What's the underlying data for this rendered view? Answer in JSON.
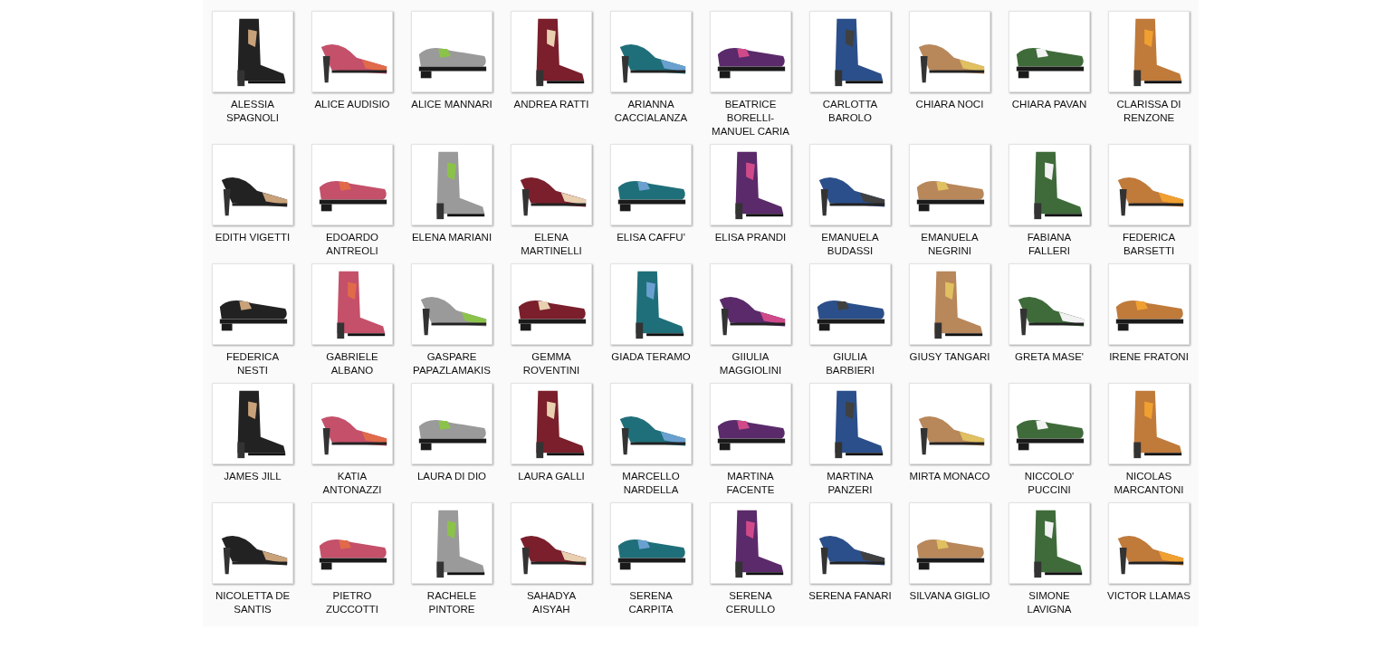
{
  "items": [
    {
      "name": "ALESSIA SPAGNOLI"
    },
    {
      "name": "ALICE AUDISIO"
    },
    {
      "name": "ALICE MANNARI"
    },
    {
      "name": "ANDREA RATTI"
    },
    {
      "name": "ARIANNA CACCIALANZA"
    },
    {
      "name": "BEATRICE BORELLI-MANUEL CARIA"
    },
    {
      "name": "CARLOTTA BAROLO"
    },
    {
      "name": "CHIARA NOCI"
    },
    {
      "name": "CHIARA PAVAN"
    },
    {
      "name": "CLARISSA DI RENZONE"
    },
    {
      "name": "EDITH VIGETTI"
    },
    {
      "name": "EDOARDO ANTREOLI"
    },
    {
      "name": "ELENA MARIANI"
    },
    {
      "name": "ELENA MARTINELLI"
    },
    {
      "name": "ELISA CAFFU'"
    },
    {
      "name": "ELISA PRANDI"
    },
    {
      "name": "EMANUELA BUDASSI"
    },
    {
      "name": "EMANUELA NEGRINI"
    },
    {
      "name": "FABIANA FALLERI"
    },
    {
      "name": "FEDERICA BARSETTI"
    },
    {
      "name": "FEDERICA NESTI"
    },
    {
      "name": "GABRIELE ALBANO"
    },
    {
      "name": "GASPARE PAPAZLAMAKIS"
    },
    {
      "name": "GEMMA ROVENTINI"
    },
    {
      "name": "GIADA TERAMO"
    },
    {
      "name": "GIIULIA MAGGIOLINI"
    },
    {
      "name": "GIULIA BARBIERI"
    },
    {
      "name": "GIUSY TANGARI"
    },
    {
      "name": "GRETA MASE'"
    },
    {
      "name": "IRENE FRATONI"
    },
    {
      "name": "JAMES JILL"
    },
    {
      "name": "KATIA ANTONAZZI"
    },
    {
      "name": "LAURA DI DIO"
    },
    {
      "name": "LAURA GALLI"
    },
    {
      "name": "MARCELLO NARDELLA"
    },
    {
      "name": "MARTINA FACENTE"
    },
    {
      "name": "MARTINA PANZERI"
    },
    {
      "name": "MIRTA MONACO"
    },
    {
      "name": "NICCOLO' PUCCINI"
    },
    {
      "name": "NICOLAS MARCANTONI"
    },
    {
      "name": "NICOLETTA DE SANTIS"
    },
    {
      "name": "PIETRO ZUCCOTTI"
    },
    {
      "name": "RACHELE PINTORE"
    },
    {
      "name": "SAHADYA AISYAH"
    },
    {
      "name": "SERENA CARPITA"
    },
    {
      "name": "SERENA CERULLO"
    },
    {
      "name": "SERENA FANARI"
    },
    {
      "name": "SILVANA GIGLIO"
    },
    {
      "name": "SIMONE LAVIGNA"
    },
    {
      "name": "VICTOR LLAMAS"
    }
  ]
}
